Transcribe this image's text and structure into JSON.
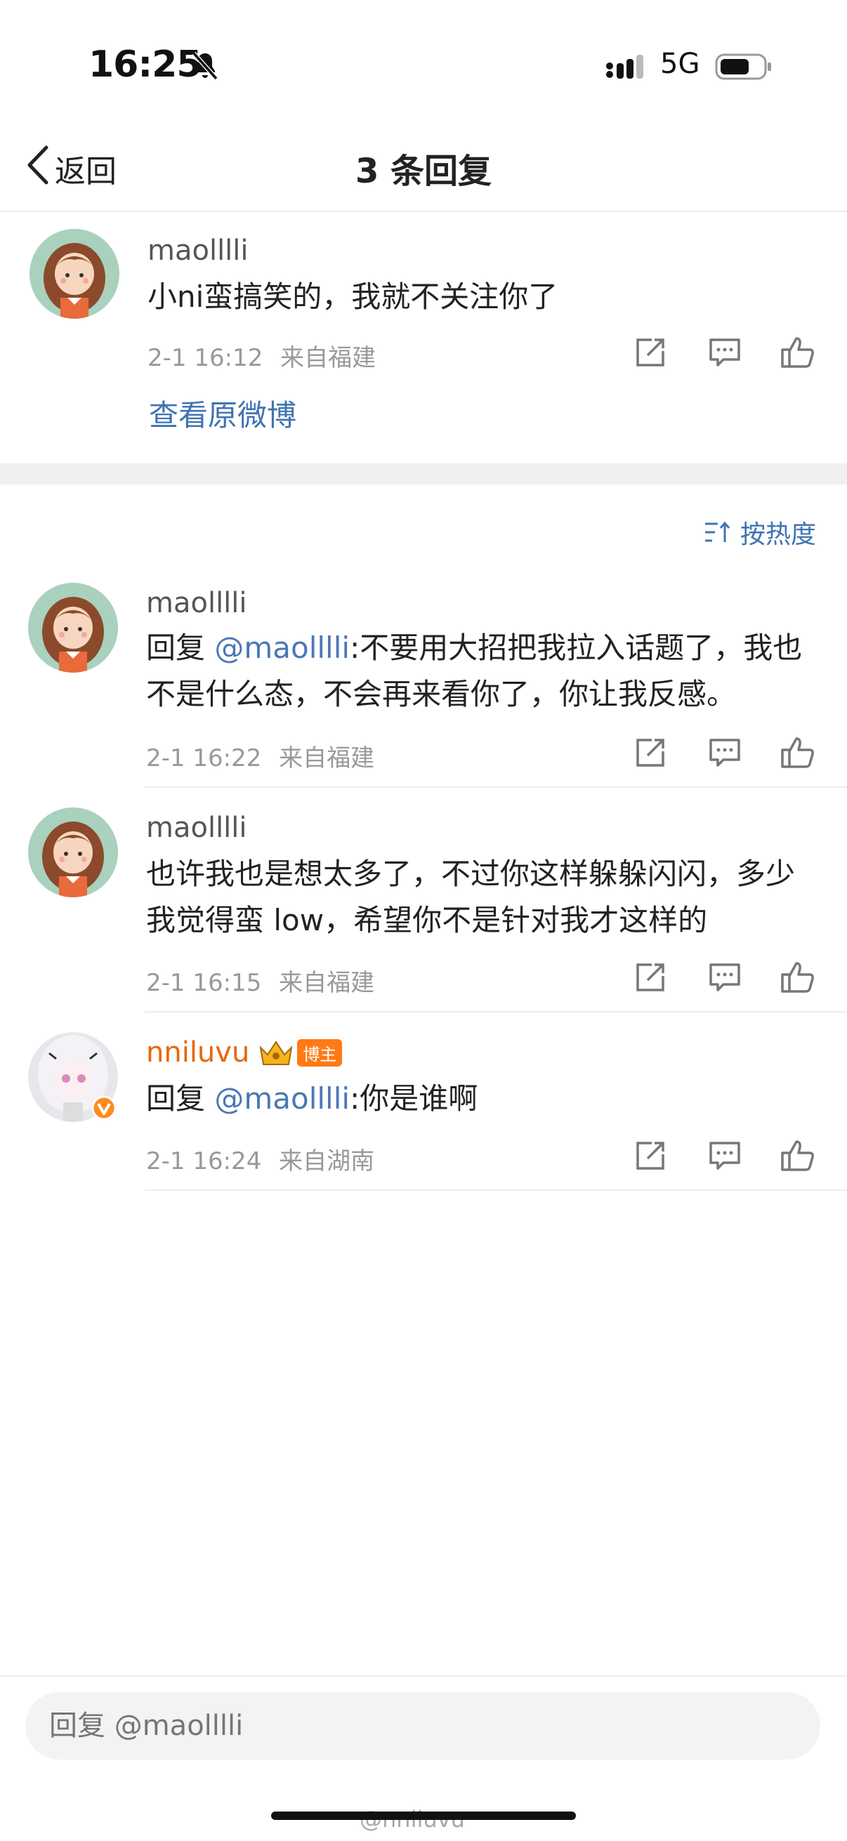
{
  "status_bar": {
    "time": "16:25",
    "network": "5G",
    "icons": [
      "bell-slash-icon",
      "signal-icon",
      "battery-icon"
    ]
  },
  "nav": {
    "back_label": "返回",
    "title": "3 条回复"
  },
  "original": {
    "user": "maolllli",
    "text": "小ni蛮搞笑的，我就不关注你了",
    "time": "2-1 16:12",
    "source": "来自福建",
    "view_original": "查看原微博"
  },
  "sort": {
    "label": "按热度"
  },
  "replies": [
    {
      "user": "maolllli",
      "prefix": "回复 ",
      "mention": "@maolllli",
      "text": ":不要用大招把我拉入话题了，我也不是什么态，不会再来看你了，你让我反感。",
      "time": "2-1 16:22",
      "source": "来自福建"
    },
    {
      "user": "maolllli",
      "text": "也许我也是想太多了，不过你这样躲躲闪闪，多少我觉得蛮 low，希望你不是针对我才这样的",
      "time": "2-1 16:15",
      "source": "来自福建"
    },
    {
      "user": "nniluvu",
      "badge": "博主",
      "prefix": "回复 ",
      "mention": "@maolllli",
      "text": ":你是谁啊",
      "time": "2-1 16:24",
      "source": "来自湖南"
    }
  ],
  "reply_input": {
    "placeholder": "回复 @maolllli"
  },
  "watermark": "@nniluvu",
  "colors": {
    "link": "#3f74b1",
    "author": "#e8660c",
    "badge": "#ff7a16"
  }
}
